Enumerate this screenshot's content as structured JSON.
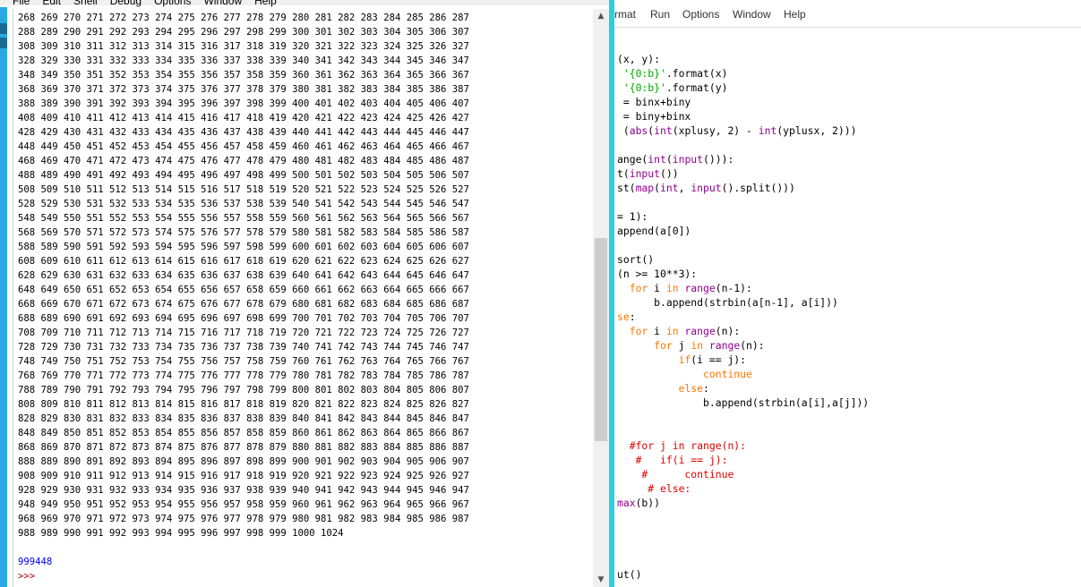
{
  "shell": {
    "menu": [
      "File",
      "Edit",
      "Shell",
      "Debug",
      "Options",
      "Window",
      "Help"
    ],
    "output_numbers_start": 268,
    "output_numbers_end": 999,
    "output_tail": "1000 1024",
    "result": "999448",
    "prompt": ">>>",
    "scroll_position": 0.62
  },
  "editor": {
    "menu": [
      "rmat",
      "Run",
      "Options",
      "Window",
      "Help"
    ],
    "lines": [
      [
        {
          "t": "(x, y):",
          "c": ""
        }
      ],
      [
        {
          "t": " ",
          "c": ""
        },
        {
          "t": "'{0:b}'",
          "c": "st"
        },
        {
          "t": ".format(x)",
          "c": ""
        }
      ],
      [
        {
          "t": " ",
          "c": ""
        },
        {
          "t": "'{0:b}'",
          "c": "st"
        },
        {
          "t": ".format(y)",
          "c": ""
        }
      ],
      [
        {
          "t": " = binx+biny",
          "c": ""
        }
      ],
      [
        {
          "t": " = biny+binx",
          "c": ""
        }
      ],
      [
        {
          "t": " (",
          "c": ""
        },
        {
          "t": "abs",
          "c": "bi"
        },
        {
          "t": "(",
          "c": ""
        },
        {
          "t": "int",
          "c": "bi"
        },
        {
          "t": "(xplusy, 2) - ",
          "c": ""
        },
        {
          "t": "int",
          "c": "bi"
        },
        {
          "t": "(yplusx, 2)))",
          "c": ""
        }
      ],
      [
        {
          "t": "",
          "c": ""
        }
      ],
      [
        {
          "t": "ange(",
          "c": ""
        },
        {
          "t": "int",
          "c": "bi"
        },
        {
          "t": "(",
          "c": ""
        },
        {
          "t": "input",
          "c": "bi"
        },
        {
          "t": "())):",
          "c": ""
        }
      ],
      [
        {
          "t": "t(",
          "c": ""
        },
        {
          "t": "input",
          "c": "bi"
        },
        {
          "t": "())",
          "c": ""
        }
      ],
      [
        {
          "t": "st(",
          "c": ""
        },
        {
          "t": "map",
          "c": "bi"
        },
        {
          "t": "(",
          "c": ""
        },
        {
          "t": "int",
          "c": "bi"
        },
        {
          "t": ", ",
          "c": ""
        },
        {
          "t": "input",
          "c": "bi"
        },
        {
          "t": "().split()))",
          "c": ""
        }
      ],
      [
        {
          "t": "",
          "c": ""
        }
      ],
      [
        {
          "t": "= 1):",
          "c": ""
        }
      ],
      [
        {
          "t": "append(a[0])",
          "c": ""
        }
      ],
      [
        {
          "t": "",
          "c": ""
        }
      ],
      [
        {
          "t": "sort()",
          "c": ""
        }
      ],
      [
        {
          "t": "(n >= 10**3):",
          "c": ""
        }
      ],
      [
        {
          "t": "  ",
          "c": ""
        },
        {
          "t": "for",
          "c": "kw"
        },
        {
          "t": " i ",
          "c": ""
        },
        {
          "t": "in",
          "c": "kw"
        },
        {
          "t": " ",
          "c": ""
        },
        {
          "t": "range",
          "c": "bi"
        },
        {
          "t": "(n-1):",
          "c": ""
        }
      ],
      [
        {
          "t": "      b.append(strbin(a[n-1], a[i]))",
          "c": ""
        }
      ],
      [
        {
          "t": "se",
          "c": "kw"
        },
        {
          "t": ":",
          "c": ""
        }
      ],
      [
        {
          "t": "  ",
          "c": ""
        },
        {
          "t": "for",
          "c": "kw"
        },
        {
          "t": " i ",
          "c": ""
        },
        {
          "t": "in",
          "c": "kw"
        },
        {
          "t": " ",
          "c": ""
        },
        {
          "t": "range",
          "c": "bi"
        },
        {
          "t": "(n):",
          "c": ""
        }
      ],
      [
        {
          "t": "      ",
          "c": ""
        },
        {
          "t": "for",
          "c": "kw"
        },
        {
          "t": " j ",
          "c": ""
        },
        {
          "t": "in",
          "c": "kw"
        },
        {
          "t": " ",
          "c": ""
        },
        {
          "t": "range",
          "c": "bi"
        },
        {
          "t": "(n):",
          "c": ""
        }
      ],
      [
        {
          "t": "          ",
          "c": ""
        },
        {
          "t": "if",
          "c": "kw"
        },
        {
          "t": "(i == j):",
          "c": ""
        }
      ],
      [
        {
          "t": "              ",
          "c": ""
        },
        {
          "t": "continue",
          "c": "kw"
        }
      ],
      [
        {
          "t": "          ",
          "c": ""
        },
        {
          "t": "else",
          "c": "kw"
        },
        {
          "t": ":",
          "c": ""
        }
      ],
      [
        {
          "t": "              b.append(strbin(a[i],a[j]))",
          "c": ""
        }
      ],
      [
        {
          "t": "",
          "c": ""
        }
      ],
      [
        {
          "t": "",
          "c": ""
        }
      ],
      [
        {
          "t": "  #for j in range(n):",
          "c": "cm"
        }
      ],
      [
        {
          "t": "   #   if(i == j):",
          "c": "cm"
        }
      ],
      [
        {
          "t": "    #      continue",
          "c": "cm"
        }
      ],
      [
        {
          "t": "     # else:",
          "c": "cm"
        }
      ],
      [
        {
          "t": "max",
          "c": "bi"
        },
        {
          "t": "(b))",
          "c": ""
        }
      ],
      [
        {
          "t": "",
          "c": ""
        }
      ],
      [
        {
          "t": "",
          "c": ""
        }
      ],
      [
        {
          "t": "",
          "c": ""
        }
      ],
      [
        {
          "t": "",
          "c": ""
        }
      ],
      [
        {
          "t": "ut()",
          "c": ""
        }
      ]
    ]
  }
}
